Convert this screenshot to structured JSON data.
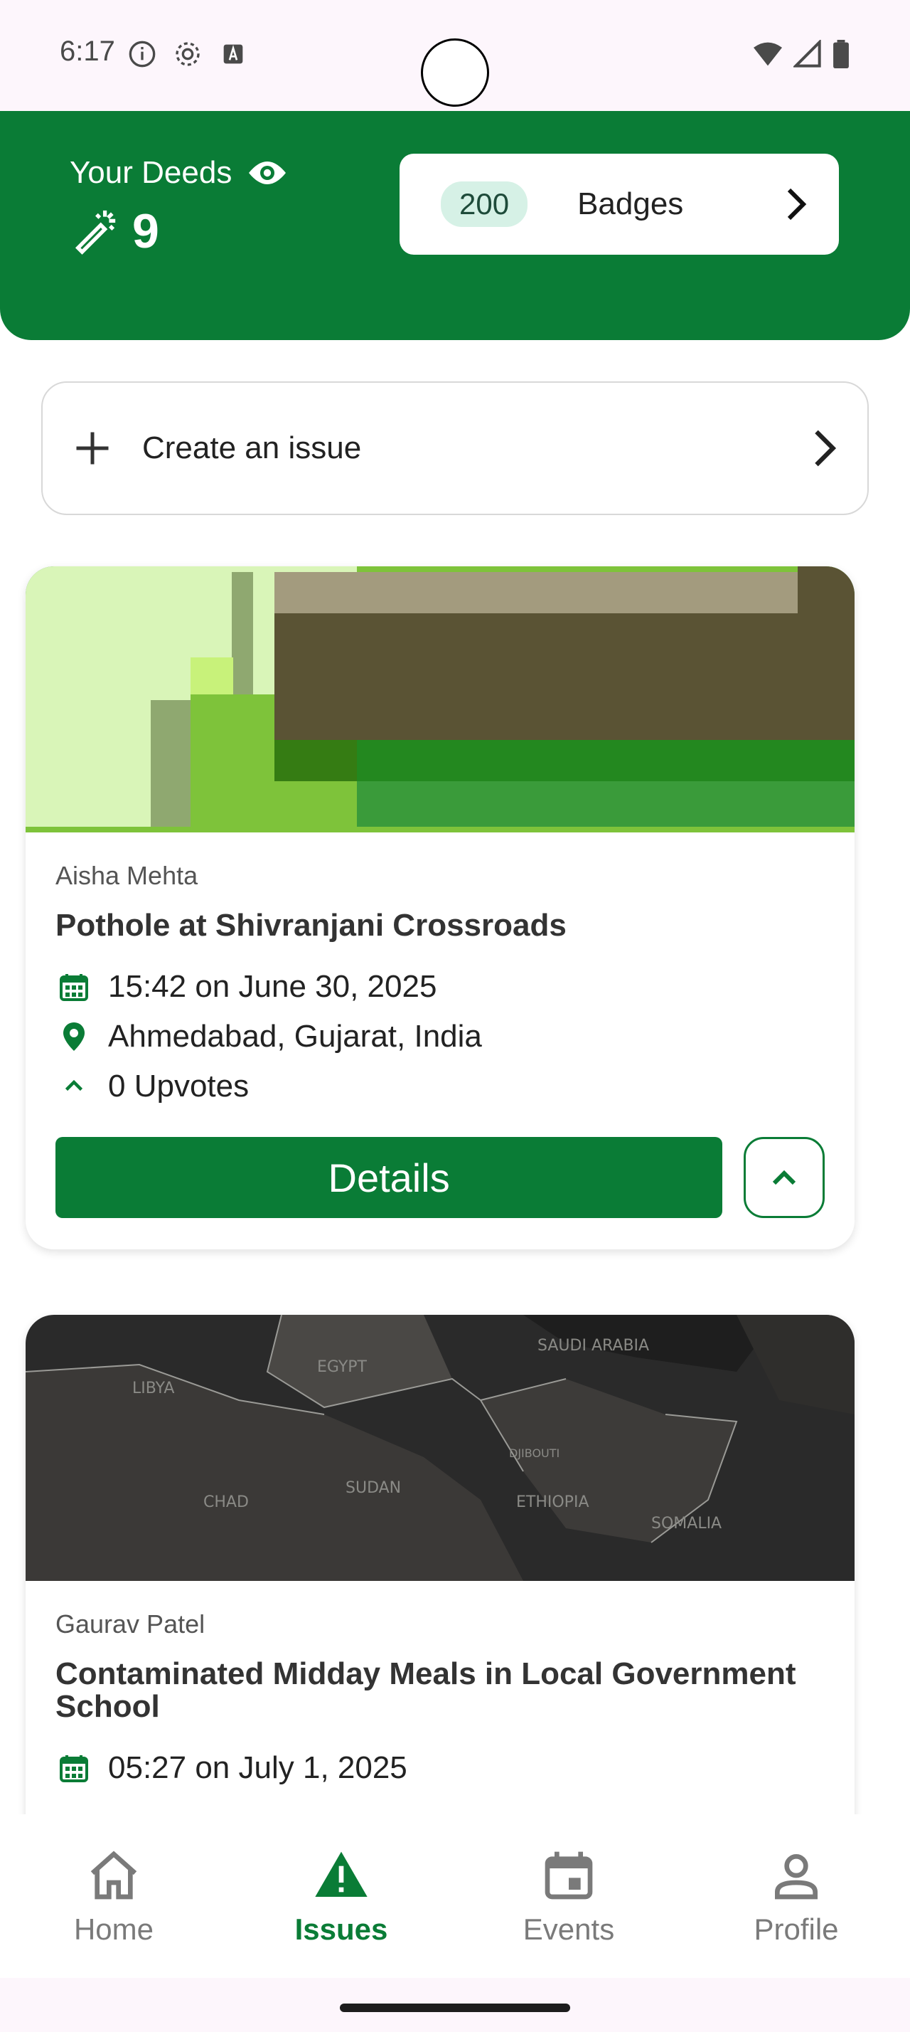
{
  "status_bar": {
    "time": "6:17"
  },
  "header": {
    "deeds_label": "Your Deeds",
    "deeds_value": "9",
    "badge_count": "200",
    "badges_label": "Badges"
  },
  "create_issue": {
    "label": "Create an issue"
  },
  "issues": [
    {
      "author": "Aisha Mehta",
      "title": "Pothole at Shivranjani Crossroads",
      "datetime": "15:42 on June 30, 2025",
      "location": "Ahmedabad, Gujarat, India",
      "upvotes": "0 Upvotes",
      "details_label": "Details"
    },
    {
      "author": "Gaurav Patel",
      "title": "Contaminated Midday Meals in Local Government School",
      "datetime": "05:27 on July 1, 2025",
      "map_labels": [
        "LIBYA",
        "EGYPT",
        "SAUDI ARABIA",
        "CHAD",
        "SUDAN",
        "ETHIOPIA",
        "SOMALIA",
        "DJIBOUTI"
      ]
    }
  ],
  "bottom_nav": {
    "items": [
      {
        "label": "Home"
      },
      {
        "label": "Issues"
      },
      {
        "label": "Events"
      },
      {
        "label": "Profile"
      }
    ],
    "active_index": 1
  },
  "colors": {
    "primary": "#0a7c36",
    "badge_bg": "#d6f1e6",
    "status_bg": "#fdf6fc"
  }
}
